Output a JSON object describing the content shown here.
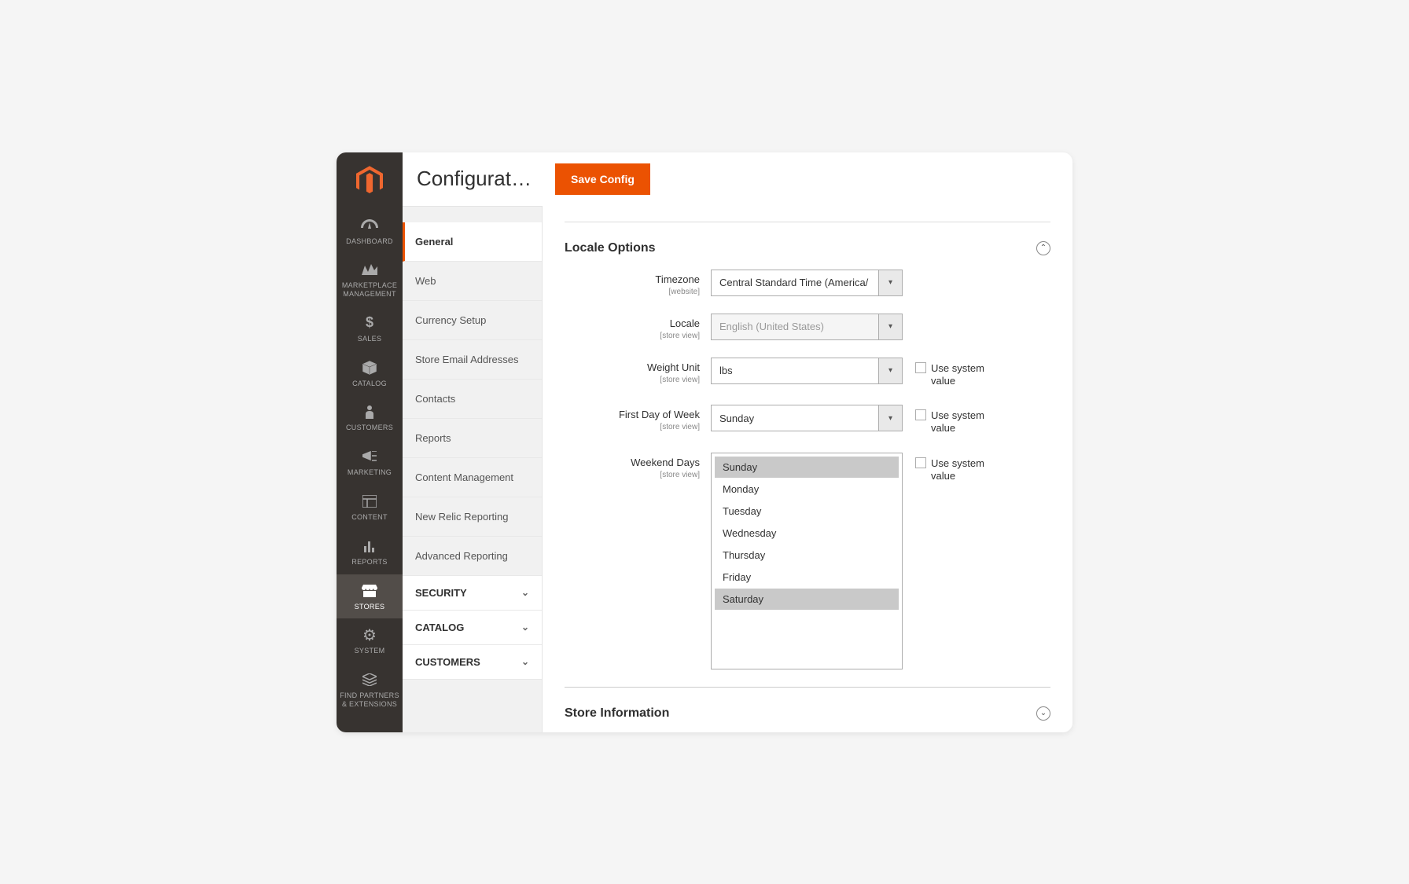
{
  "header": {
    "title": "Configuration",
    "save_label": "Save Config"
  },
  "sidebar": {
    "items": [
      {
        "label": "DASHBOARD"
      },
      {
        "label": "MARKETPLACE MANAGEMENT"
      },
      {
        "label": "SALES"
      },
      {
        "label": "CATALOG"
      },
      {
        "label": "CUSTOMERS"
      },
      {
        "label": "MARKETING"
      },
      {
        "label": "CONTENT"
      },
      {
        "label": "REPORTS"
      },
      {
        "label": "STORES"
      },
      {
        "label": "SYSTEM"
      },
      {
        "label": "FIND PARTNERS & EXTENSIONS"
      }
    ]
  },
  "config_nav": {
    "items": [
      {
        "label": "General"
      },
      {
        "label": "Web"
      },
      {
        "label": "Currency Setup"
      },
      {
        "label": "Store Email Addresses"
      },
      {
        "label": "Contacts"
      },
      {
        "label": "Reports"
      },
      {
        "label": "Content Management"
      },
      {
        "label": "New Relic Reporting"
      },
      {
        "label": "Advanced Reporting"
      }
    ],
    "sections": [
      {
        "label": "SECURITY"
      },
      {
        "label": "CATALOG"
      },
      {
        "label": "CUSTOMERS"
      }
    ]
  },
  "locale": {
    "section_title": "Locale Options",
    "timezone": {
      "label": "Timezone",
      "scope": "[website]",
      "value": "Central Standard Time (America/"
    },
    "locale": {
      "label": "Locale",
      "scope": "[store view]",
      "value": "English (United States)"
    },
    "weight": {
      "label": "Weight Unit",
      "scope": "[store view]",
      "value": "lbs"
    },
    "first_day": {
      "label": "First Day of Week",
      "scope": "[store view]",
      "value": "Sunday"
    },
    "weekend": {
      "label": "Weekend Days",
      "scope": "[store view]",
      "options": [
        "Sunday",
        "Monday",
        "Tuesday",
        "Wednesday",
        "Thursday",
        "Friday",
        "Saturday"
      ]
    },
    "use_system_label": "Use system value"
  },
  "next_section": {
    "title": "Store Information"
  }
}
